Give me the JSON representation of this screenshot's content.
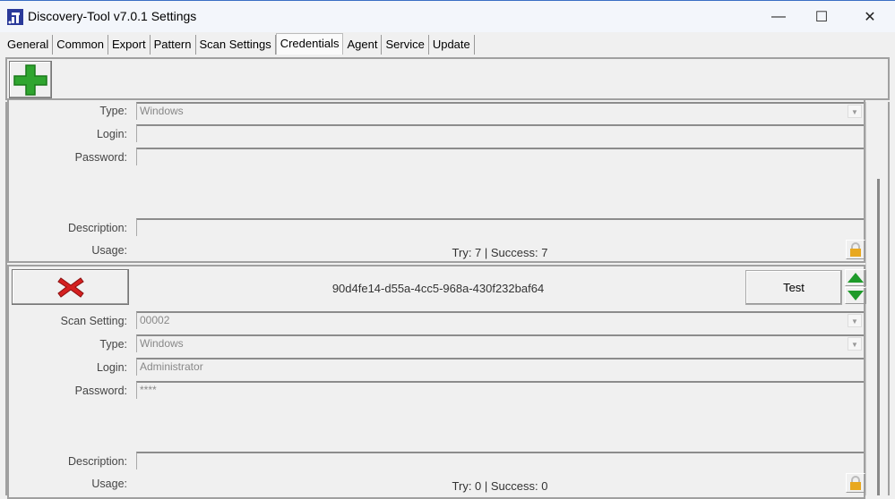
{
  "window": {
    "title": "Discovery-Tool v7.0.1 Settings",
    "minimize": "—",
    "maximize": "☐",
    "close": "✕"
  },
  "tabs": [
    {
      "label": "General"
    },
    {
      "label": "Common"
    },
    {
      "label": "Export"
    },
    {
      "label": "Pattern"
    },
    {
      "label": "Scan Settings"
    },
    {
      "label": "Credentials",
      "active": true
    },
    {
      "label": "Agent"
    },
    {
      "label": "Service"
    },
    {
      "label": "Update"
    }
  ],
  "labels": {
    "scan_setting": "Scan Setting:",
    "type": "Type:",
    "login": "Login:",
    "password": "Password:",
    "description": "Description:",
    "usage": "Usage:"
  },
  "credentials": [
    {
      "type": "Windows",
      "login": "",
      "password": "",
      "description": "",
      "usage": "Try: 7 | Success: 7"
    },
    {
      "id": "90d4fe14-d55a-4cc5-968a-430f232baf64",
      "test_label": "Test",
      "scan_setting": "00002",
      "type": "Windows",
      "login": "Administrator",
      "password": "****",
      "description": "",
      "usage": "Try: 0 | Success: 0"
    }
  ],
  "colors": {
    "add": "#2fa52f",
    "delete": "#d42020",
    "move": "#1e9a2a",
    "lock": "#e8a820"
  }
}
